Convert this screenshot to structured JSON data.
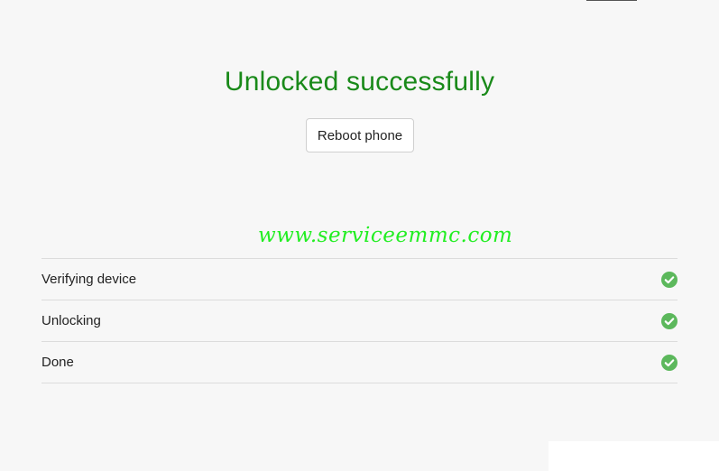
{
  "status": {
    "title": "Unlocked successfully",
    "title_color": "#1a8a1a"
  },
  "actions": {
    "reboot_label": "Reboot phone"
  },
  "watermark": {
    "text": "www.serviceemmc.com",
    "color": "#22ee22"
  },
  "steps": [
    {
      "label": "Verifying device",
      "icon": "check-circle-icon",
      "state": "done"
    },
    {
      "label": "Unlocking",
      "icon": "check-circle-icon",
      "state": "done"
    },
    {
      "label": "Done",
      "icon": "check-circle-icon",
      "state": "done"
    }
  ],
  "colors": {
    "success": "#5cb85c",
    "background": "#f7f7f7",
    "divider": "#dcdcdc"
  }
}
